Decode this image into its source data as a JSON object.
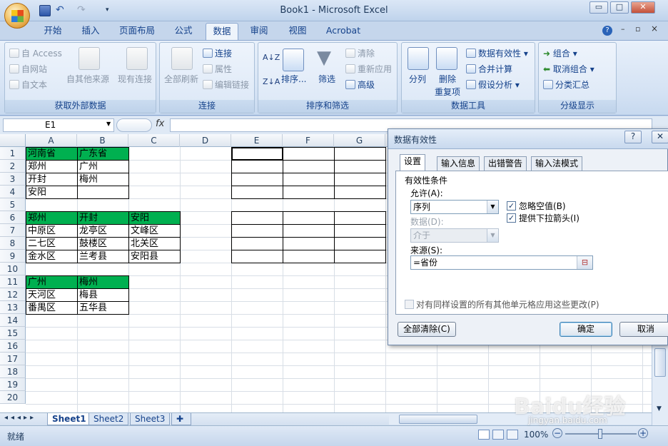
{
  "window": {
    "title": "Book1 - Microsoft Excel",
    "minimize": "▭",
    "restore": "□",
    "close": "✕"
  },
  "ribbon_tabs": [
    "开始",
    "插入",
    "页面布局",
    "公式",
    "数据",
    "审阅",
    "视图",
    "Acrobat"
  ],
  "active_tab": "数据",
  "ribbon": {
    "get_external": {
      "label": "获取外部数据",
      "access": "自 Access",
      "web": "自网站",
      "text": "自文本",
      "other": "自其他来源",
      "existing": "现有连接"
    },
    "connections": {
      "label": "连接",
      "refresh_all": "全部刷新",
      "connections": "连接",
      "properties": "属性",
      "edit_links": "编辑链接"
    },
    "sort_filter": {
      "label": "排序和筛选",
      "sort": "排序...",
      "filter": "筛选",
      "clear": "清除",
      "reapply": "重新应用",
      "advanced": "高级"
    },
    "data_tools": {
      "label": "数据工具",
      "text_to_columns": "分列",
      "remove_dup_1": "删除",
      "remove_dup_2": "重复项",
      "validation": "数据有效性",
      "consolidate": "合并计算",
      "whatif": "假设分析"
    },
    "outline": {
      "label": "分级显示",
      "group": "组合",
      "ungroup": "取消组合",
      "subtotal": "分类汇总"
    }
  },
  "formula_bar": {
    "name_box": "E1",
    "fx": "fx",
    "formula": ""
  },
  "columns": [
    "A",
    "B",
    "C",
    "D",
    "E",
    "F",
    "G"
  ],
  "rows": [
    "1",
    "2",
    "3",
    "4",
    "5",
    "6",
    "7",
    "8",
    "9",
    "10",
    "11",
    "12",
    "13",
    "14",
    "15",
    "16",
    "17",
    "18",
    "19",
    "20"
  ],
  "cells": {
    "A1": "河南省",
    "B1": "广东省",
    "A2": "郑州",
    "B2": "广州",
    "A3": "开封",
    "B3": "梅州",
    "A4": "安阳",
    "A6": "郑州",
    "B6": "开封",
    "C6": "安阳",
    "A7": "中原区",
    "B7": "龙亭区",
    "C7": "文峰区",
    "A8": "二七区",
    "B8": "鼓楼区",
    "C8": "北关区",
    "A9": "金水区",
    "B9": "兰考县",
    "C9": "安阳县",
    "A11": "广州",
    "B11": "梅州",
    "A12": "天河区",
    "B12": "梅县",
    "A13": "番禺区",
    "B13": "五华县"
  },
  "green_color": "#00b050",
  "sheet_tabs": [
    "Sheet1",
    "Sheet2",
    "Sheet3"
  ],
  "active_sheet": "Sheet1",
  "status": {
    "mode": "就绪",
    "zoom": "100%"
  },
  "dialog": {
    "title": "数据有效性",
    "help": "?",
    "close": "✕",
    "tabs": [
      "设置",
      "输入信息",
      "出错警告",
      "输入法模式"
    ],
    "active_tab": "设置",
    "section": "有效性条件",
    "allow_label": "允许(A):",
    "allow_value": "序列",
    "data_label": "数据(D):",
    "data_value": "介于",
    "ignore_blank": "忽略空值(B)",
    "ignore_blank_checked": true,
    "dropdown": "提供下拉箭头(I)",
    "dropdown_checked": true,
    "source_label": "来源(S):",
    "source_value": "=省份",
    "apply_all": "对有同样设置的所有其他单元格应用这些更改(P)",
    "apply_all_checked": false,
    "clear_all": "全部清除(C)",
    "ok": "确定",
    "cancel": "取消"
  },
  "watermark": {
    "logo": "Baidu经验",
    "url": "jingyan.baidu.com"
  }
}
